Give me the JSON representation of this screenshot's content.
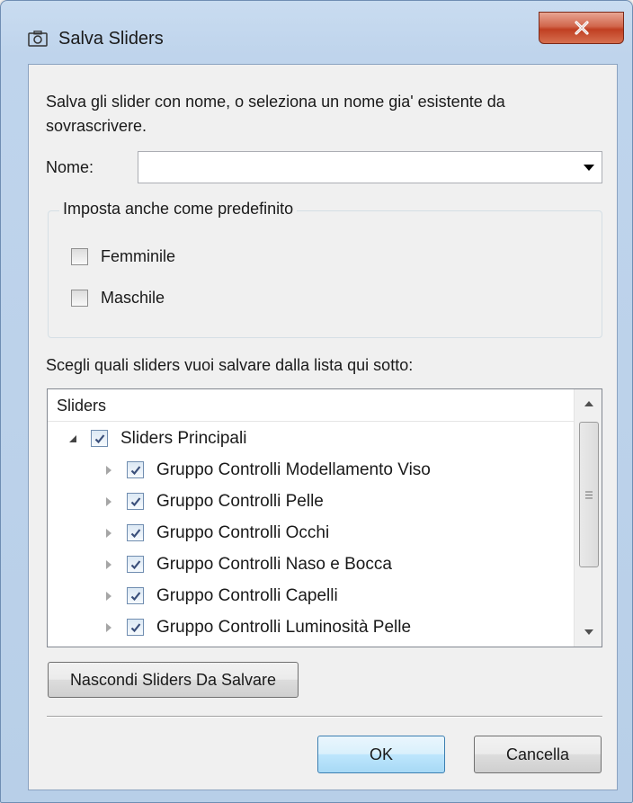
{
  "window": {
    "title": "Salva Sliders",
    "close_label": "X"
  },
  "intro_text": "Salva gli slider con nome, o seleziona un nome gia' esistente da sovrascrivere.",
  "nome": {
    "label": "Nome:",
    "value": ""
  },
  "default_group": {
    "title": "Imposta anche come predefinito",
    "options": [
      {
        "label": "Femminile",
        "checked": false
      },
      {
        "label": "Maschile",
        "checked": false
      }
    ]
  },
  "list_label": "Scegli quali sliders vuoi salvare dalla lista qui sotto:",
  "tree": {
    "header": "Sliders",
    "root": {
      "label": "Sliders Principali",
      "checked": true,
      "expanded": true
    },
    "children": [
      {
        "label": "Gruppo Controlli Modellamento Viso",
        "checked": true
      },
      {
        "label": "Gruppo Controlli Pelle",
        "checked": true
      },
      {
        "label": "Gruppo Controlli Occhi",
        "checked": true
      },
      {
        "label": "Gruppo Controlli Naso e Bocca",
        "checked": true
      },
      {
        "label": "Gruppo Controlli Capelli",
        "checked": true
      },
      {
        "label": "Gruppo Controlli Luminosità Pelle",
        "checked": true
      }
    ]
  },
  "buttons": {
    "hide_sliders": "Nascondi Sliders Da Salvare",
    "ok": "OK",
    "cancel": "Cancella"
  }
}
